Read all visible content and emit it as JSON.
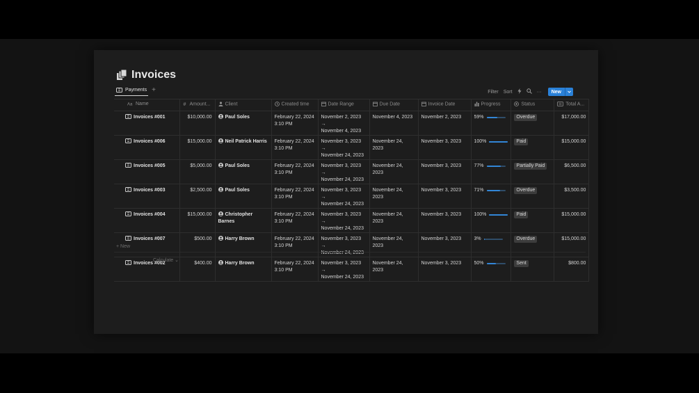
{
  "page": {
    "title": "Invoices"
  },
  "tabs": {
    "active": "Payments",
    "add": "+"
  },
  "toolbar": {
    "filter": "Filter",
    "sort": "Sort",
    "more": "···",
    "new": "New"
  },
  "columns": {
    "name": "Name",
    "amount": "Amount...",
    "client": "Client",
    "created": "Created time",
    "range": "Date Range",
    "due": "Due Date",
    "invoice_date": "Invoice Date",
    "progress": "Progress",
    "status": "Status",
    "total": "Total A..."
  },
  "rows": [
    {
      "name": "Invoices #001",
      "amount": "$10,000.00",
      "client": "Paul Soles",
      "client2": "",
      "created1": "February 22, 2024",
      "created2": "3:10 PM",
      "range1": "November 2, 2023 →",
      "range2": "November 4, 2023",
      "due": "November 4, 2023",
      "invoice_date": "November 2, 2023",
      "progress_label": "59%",
      "progress": 0.59,
      "status": "Overdue",
      "total": "$17,000.00"
    },
    {
      "name": "Invoices #006",
      "amount": "$15,000.00",
      "client": "Neil Patrick Harris",
      "client2": "",
      "created1": "February 22, 2024",
      "created2": "3:10 PM",
      "range1": "November 3, 2023 →",
      "range2": "November 24, 2023",
      "due": "November 24, 2023",
      "invoice_date": "November 3, 2023",
      "progress_label": "100%",
      "progress": 1.0,
      "status": "Paid",
      "total": "$15,000.00"
    },
    {
      "name": "Invoices #005",
      "amount": "$5,000.00",
      "client": "Paul Soles",
      "client2": "",
      "created1": "February 22, 2024",
      "created2": "3:10 PM",
      "range1": "November 3, 2023 →",
      "range2": "November 24, 2023",
      "due": "November 24, 2023",
      "invoice_date": "November 3, 2023",
      "progress_label": "77%",
      "progress": 0.77,
      "status": "Partially Paid",
      "total": "$6,500.00"
    },
    {
      "name": "Invoices #003",
      "amount": "$2,500.00",
      "client": "Paul Soles",
      "client2": "",
      "created1": "February 22, 2024",
      "created2": "3:10 PM",
      "range1": "November 3, 2023 →",
      "range2": "November 24, 2023",
      "due": "November 24, 2023",
      "invoice_date": "November 3, 2023",
      "progress_label": "71%",
      "progress": 0.71,
      "status": "Overdue",
      "total": "$3,500.00"
    },
    {
      "name": "Invoices #004",
      "amount": "$15,000.00",
      "client": "Christopher",
      "client2": "Barnes",
      "created1": "February 22, 2024",
      "created2": "3:10 PM",
      "range1": "November 3, 2023 →",
      "range2": "November 24, 2023",
      "due": "November 24, 2023",
      "invoice_date": "November 3, 2023",
      "progress_label": "100%",
      "progress": 1.0,
      "status": "Paid",
      "total": "$15,000.00"
    },
    {
      "name": "Invoices #007",
      "amount": "$500.00",
      "client": "Harry Brown",
      "client2": "",
      "created1": "February 22, 2024",
      "created2": "3:10 PM",
      "range1": "November 3, 2023 →",
      "range2": "November 24, 2023",
      "due": "November 24, 2023",
      "invoice_date": "November 3, 2023",
      "progress_label": "3%",
      "progress": 0.03,
      "status": "Overdue",
      "total": "$15,000.00"
    },
    {
      "name": "Invoices #002",
      "amount": "$400.00",
      "client": "Harry Brown",
      "client2": "",
      "created1": "February 22, 2024",
      "created2": "3:10 PM",
      "range1": "November 3, 2023 →",
      "range2": "November 24, 2023",
      "due": "November 24, 2023",
      "invoice_date": "November 3, 2023",
      "progress_label": "50%",
      "progress": 0.5,
      "status": "Sent",
      "total": "$800.00"
    }
  ],
  "footer": {
    "new_row": "+ New",
    "calculate": "Calculate ⌄"
  }
}
